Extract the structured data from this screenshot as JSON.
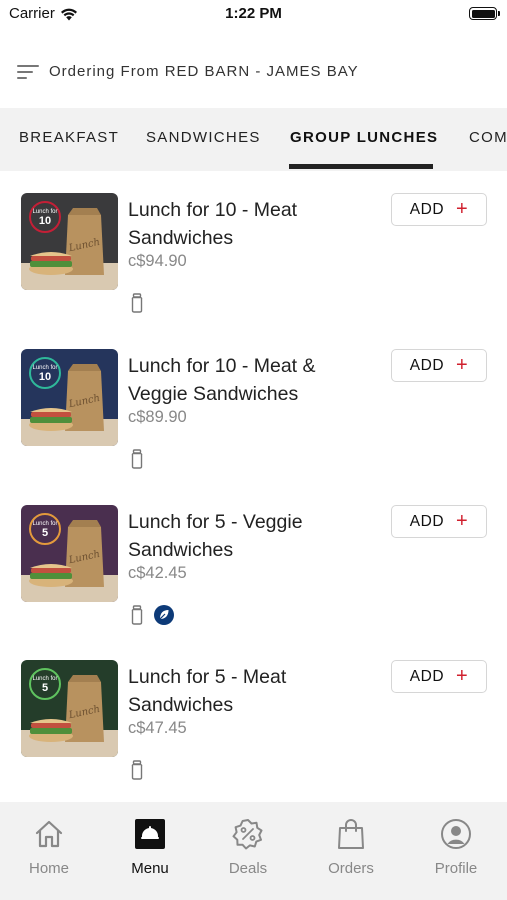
{
  "status_bar": {
    "carrier": "Carrier",
    "time": "1:22 PM"
  },
  "header": {
    "title": "Ordering From RED BARN - JAMES BAY"
  },
  "tabs": [
    {
      "label": "BREAKFAST",
      "active": false
    },
    {
      "label": "SANDWICHES",
      "active": false
    },
    {
      "label": "GROUP LUNCHES",
      "active": true
    },
    {
      "label": "COM",
      "active": false
    }
  ],
  "menu_items": [
    {
      "title": "Lunch for 10 - Meat Sandwiches",
      "price": "c$94.90",
      "add_label": "ADD",
      "add_icon": "+",
      "badge_top": "Lunch for",
      "badge_num": "10",
      "bag_text": "Lunch",
      "icons": [
        "jar-icon"
      ],
      "bg": "#3a3a3c",
      "badge_ring": "#c41f36"
    },
    {
      "title": "Lunch for 10 - Meat & Veggie Sandwiches",
      "price": "c$89.90",
      "add_label": "ADD",
      "add_icon": "+",
      "badge_top": "Lunch for",
      "badge_num": "10",
      "bag_text": "Lunch",
      "icons": [
        "jar-icon"
      ],
      "bg": "#25355c",
      "badge_ring": "#2fb89a"
    },
    {
      "title": "Lunch for 5 - Veggie Sandwiches",
      "price": "c$42.45",
      "add_label": "ADD",
      "add_icon": "+",
      "badge_top": "Lunch for",
      "badge_num": "5",
      "bag_text": "Lunch",
      "icons": [
        "jar-icon",
        "leaf-icon"
      ],
      "bg": "#4a2f4f",
      "badge_ring": "#e39a3c"
    },
    {
      "title": "Lunch for 5 - Meat Sandwiches",
      "price": "c$47.45",
      "add_label": "ADD",
      "add_icon": "+",
      "badge_top": "Lunch for",
      "badge_num": "5",
      "bag_text": "Lunch",
      "icons": [
        "jar-icon"
      ],
      "bg": "#243d2a",
      "badge_ring": "#5fc35f"
    }
  ],
  "bottom_nav": [
    {
      "label": "Home",
      "icon": "home-icon",
      "active": false
    },
    {
      "label": "Menu",
      "icon": "menu-icon",
      "active": true
    },
    {
      "label": "Deals",
      "icon": "deals-icon",
      "active": false
    },
    {
      "label": "Orders",
      "icon": "orders-icon",
      "active": false
    },
    {
      "label": "Profile",
      "icon": "profile-icon",
      "active": false
    }
  ],
  "colors": {
    "accent": "#d0202e",
    "leaf_badge": "#0d3a78"
  }
}
